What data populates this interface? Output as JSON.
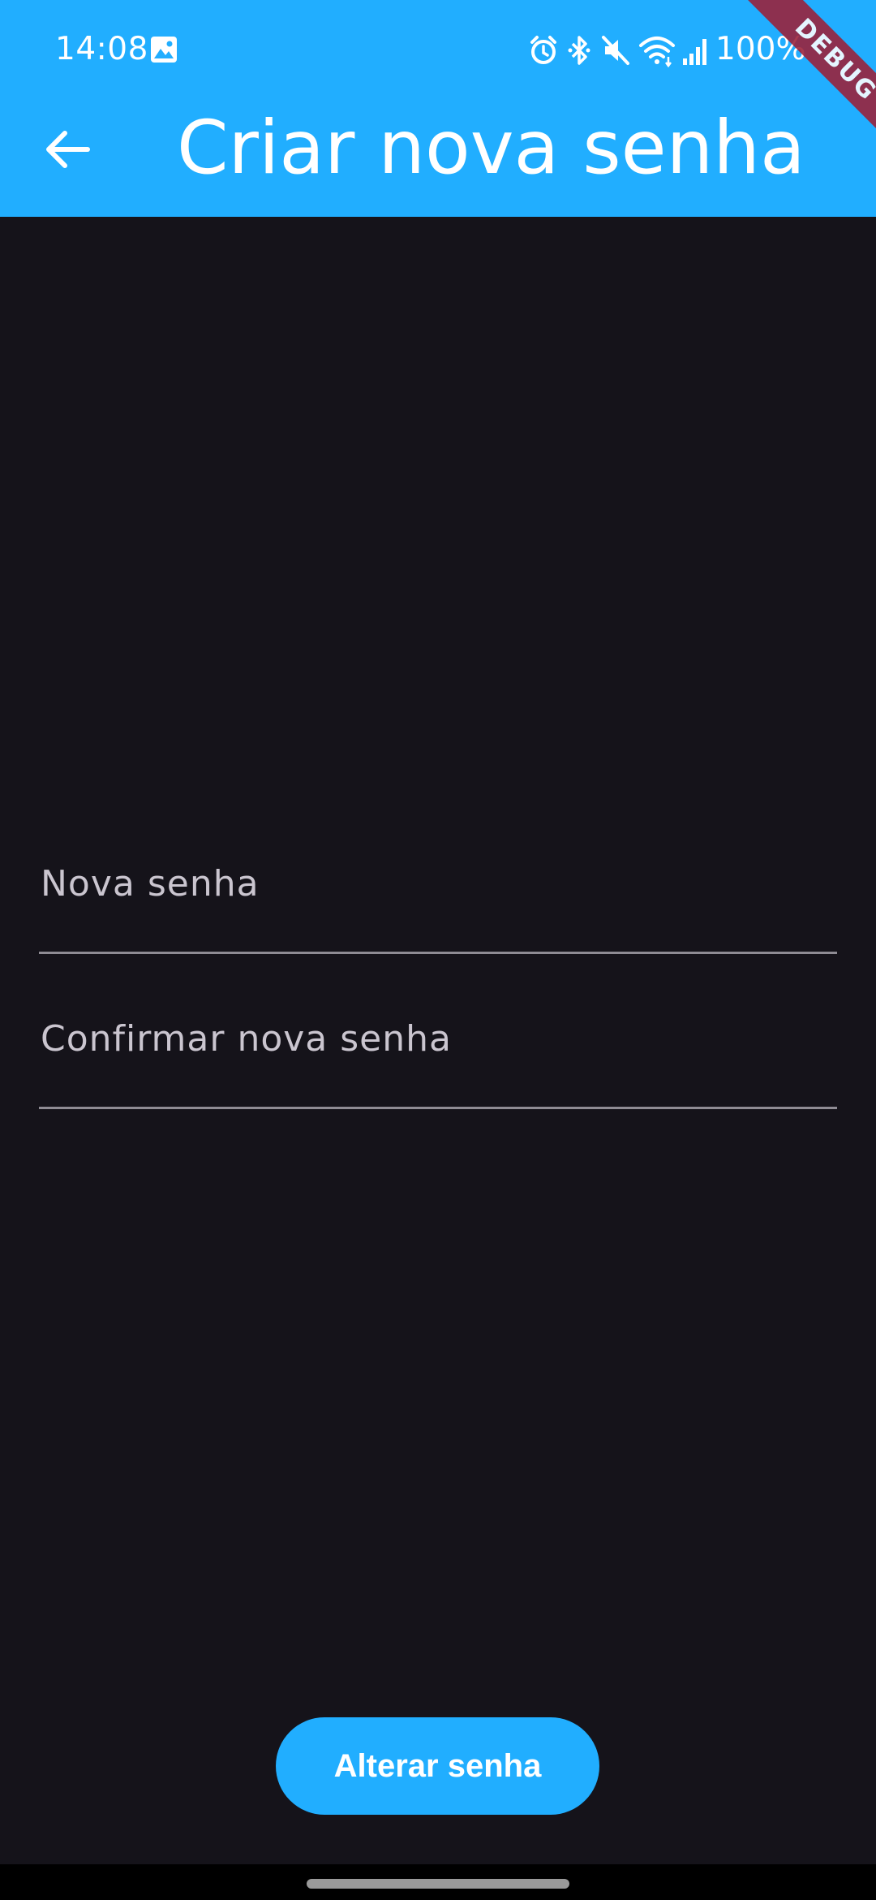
{
  "status_bar": {
    "time": "14:08",
    "battery": "100%",
    "icons": [
      "gallery-icon",
      "alarm-icon",
      "bluetooth-icon",
      "mute-icon",
      "wifi-icon",
      "signal-icon"
    ]
  },
  "app_bar": {
    "title": "Criar nova senha",
    "back_icon": "arrow-back-icon",
    "debug_banner": "DEBUG"
  },
  "form": {
    "new_password": {
      "label": "Nova senha",
      "value": ""
    },
    "confirm_password": {
      "label": "Confirmar nova senha",
      "value": ""
    },
    "submit_label": "Alterar senha"
  },
  "colors": {
    "primary": "#21aeff",
    "background": "#15131a",
    "label": "#cac5cf",
    "underline": "#8f8c94",
    "debug_ribbon": "#9c1f37"
  }
}
